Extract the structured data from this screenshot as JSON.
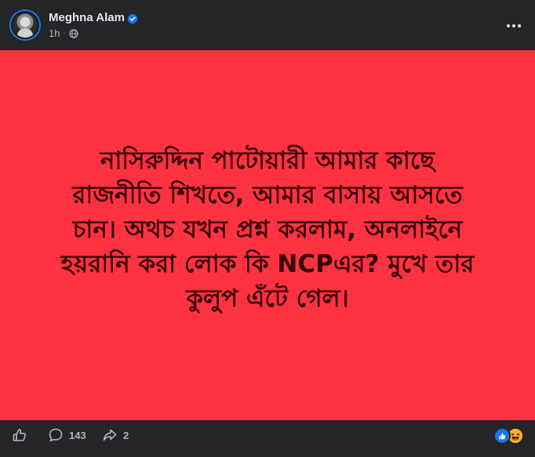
{
  "post": {
    "author": "Meghna Alam",
    "verified": true,
    "time": "1h",
    "privacy_icon": "globe-icon",
    "more_icon": "more-options-icon",
    "background_color": "#fe3241",
    "text_color": "#3a0205",
    "text": "নাসিরুদ্দিন পাটোয়ারী আমার কাছে\nরাজনীতি শিখতে, আমার বাসায় আসতে\nচান। অথচ যখন প্রশ্ন করলাম, অনলাইনে\nহয়রানি করা লোক কি NCPএর? মুখে তার\nকুলুপ এঁটে গেল।"
  },
  "footer": {
    "like_icon": "thumbs-up-icon",
    "comment_icon": "comment-icon",
    "comment_count": "143",
    "share_icon": "share-icon",
    "share_count": "2",
    "reaction_icons": [
      "like-reaction-icon",
      "haha-reaction-icon"
    ]
  },
  "colors": {
    "card_bg": "#242526",
    "text_primary": "#e4e6eb",
    "text_secondary": "#b0b3b8",
    "accent": "#1877f2"
  }
}
